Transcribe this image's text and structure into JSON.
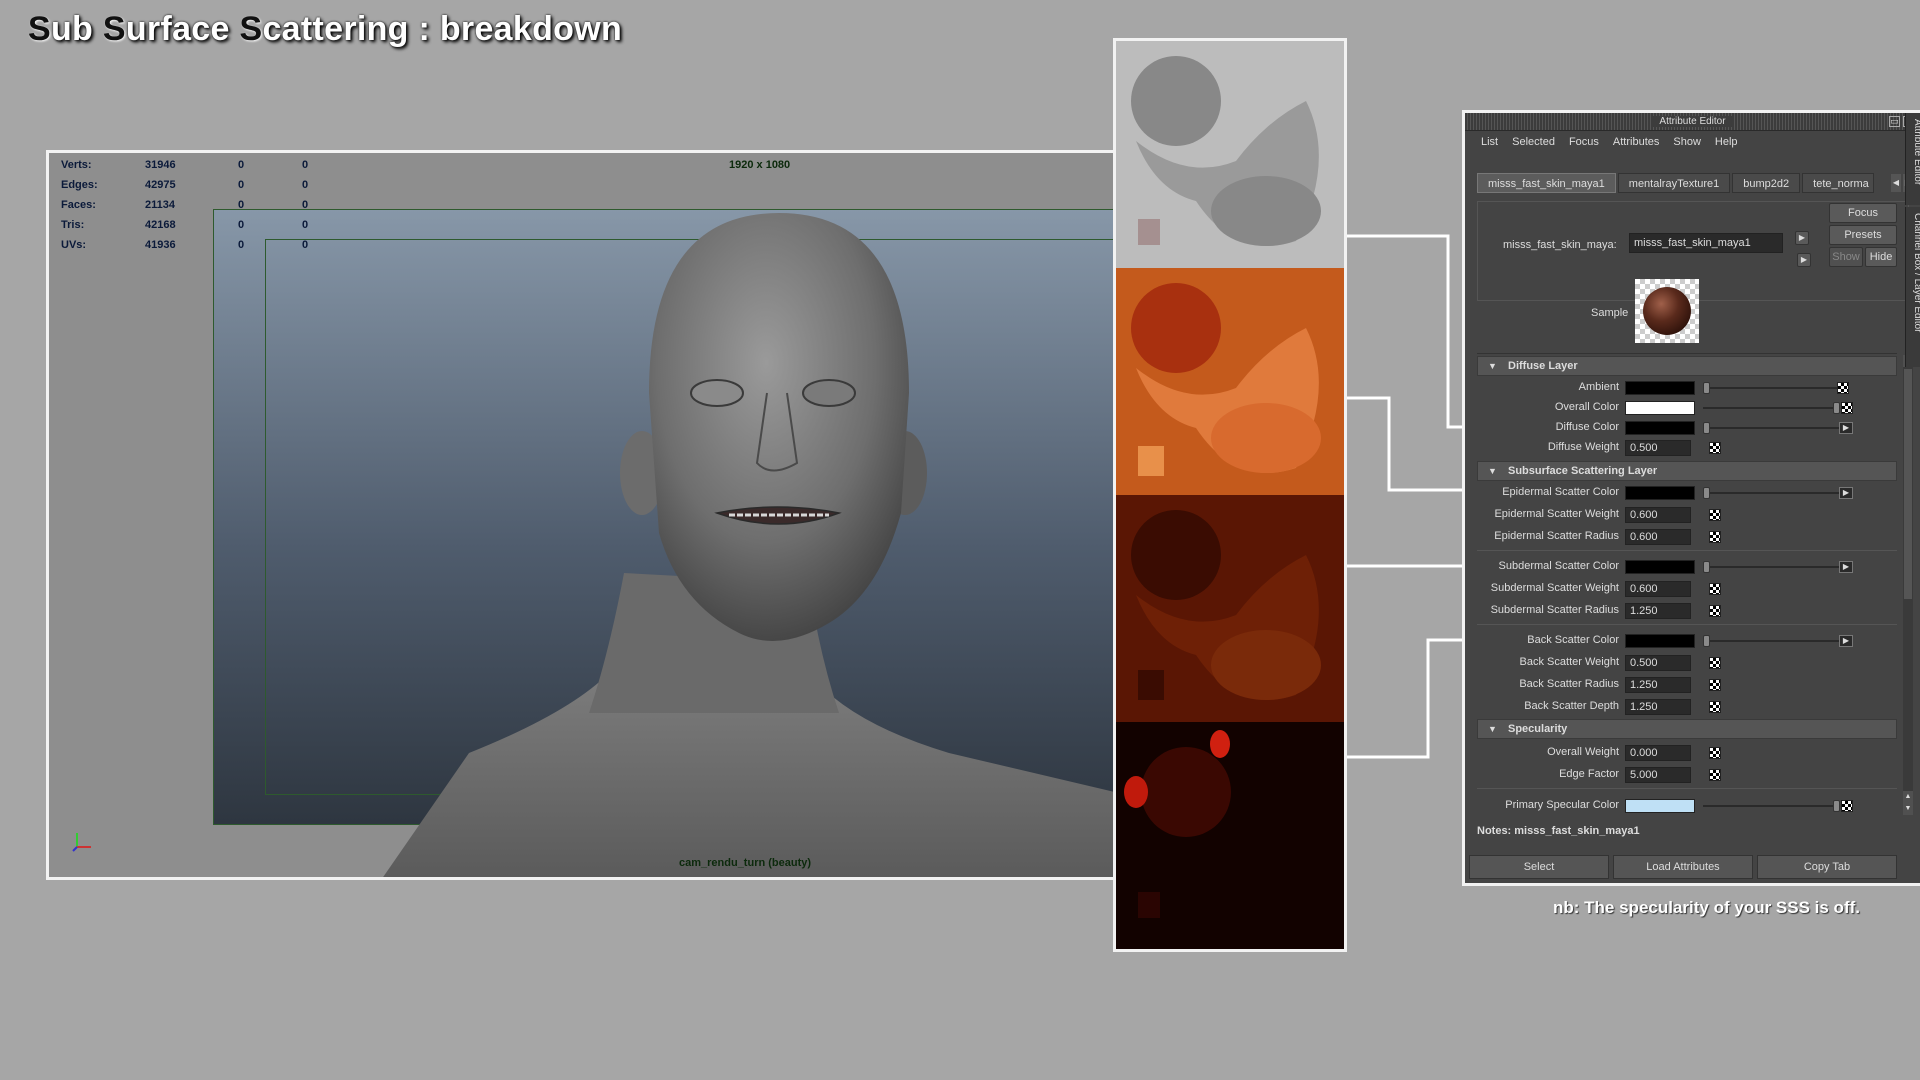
{
  "title": {
    "parts": [
      {
        "text": "S",
        "cap": true
      },
      {
        "text": "ub ",
        "cap": false
      },
      {
        "text": "S",
        "cap": true
      },
      {
        "text": "urface ",
        "cap": false
      },
      {
        "text": "S",
        "cap": true
      },
      {
        "text": "cattering : breakdown",
        "cap": false
      }
    ]
  },
  "viewport": {
    "hud": [
      {
        "label": "Verts:",
        "v1": "31946",
        "v2": "0",
        "v3": "0"
      },
      {
        "label": "Edges:",
        "v1": "42975",
        "v2": "0",
        "v3": "0"
      },
      {
        "label": "Faces:",
        "v1": "21134",
        "v2": "0",
        "v3": "0"
      },
      {
        "label": "Tris:",
        "v1": "42168",
        "v2": "0",
        "v3": "0"
      },
      {
        "label": "UVs:",
        "v1": "41936",
        "v2": "0",
        "v3": "0"
      }
    ],
    "resolution": "1920 x 1080",
    "camera": "cam_rendu_turn (beauty)"
  },
  "attribute_editor": {
    "title": "Attribute Editor",
    "menu": [
      "List",
      "Selected",
      "Focus",
      "Attributes",
      "Show",
      "Help"
    ],
    "tabs": [
      "misss_fast_skin_maya1",
      "mentalrayTexture1",
      "bump2d2",
      "tete_norma"
    ],
    "node_label": "misss_fast_skin_maya:",
    "node_value": "misss_fast_skin_maya1",
    "buttons": {
      "focus": "Focus",
      "presets": "Presets",
      "show": "Show",
      "hide": "Hide"
    },
    "sample_label": "Sample",
    "sections": {
      "diffuse": "Diffuse Layer",
      "sss": "Subsurface Scattering Layer",
      "spec": "Specularity"
    },
    "attrs": {
      "ambient": "Ambient",
      "overall_color": "Overall Color",
      "diffuse_color": "Diffuse Color",
      "diffuse_weight": {
        "label": "Diffuse Weight",
        "value": "0.500"
      },
      "epi_color": "Epidermal Scatter Color",
      "epi_weight": {
        "label": "Epidermal Scatter Weight",
        "value": "0.600"
      },
      "epi_radius": {
        "label": "Epidermal Scatter Radius",
        "value": "0.600"
      },
      "sub_color": "Subdermal Scatter Color",
      "sub_weight": {
        "label": "Subdermal Scatter Weight",
        "value": "0.600"
      },
      "sub_radius": {
        "label": "Subdermal Scatter Radius",
        "value": "1.250"
      },
      "back_color": "Back Scatter Color",
      "back_weight": {
        "label": "Back Scatter Weight",
        "value": "0.500"
      },
      "back_radius": {
        "label": "Back Scatter Radius",
        "value": "1.250"
      },
      "back_depth": {
        "label": "Back Scatter Depth",
        "value": "1.250"
      },
      "spec_weight": {
        "label": "Overall Weight",
        "value": "0.000"
      },
      "edge_factor": {
        "label": "Edge Factor",
        "value": "5.000"
      },
      "primary_spec": "Primary Specular Color"
    },
    "swatch_colors": {
      "ambient": "#000000",
      "overall": "#ffffff",
      "diffuse": "#000000",
      "epi": "#000000",
      "sub": "#000000",
      "back": "#000000",
      "primary_spec": "#bfe0f5"
    },
    "notes": "Notes:  misss_fast_skin_maya1",
    "bottom_buttons": [
      "Select",
      "Load Attributes",
      "Copy Tab"
    ],
    "side_tabs": [
      "Attribute Editor",
      "Channel Box / Layer Editor"
    ]
  },
  "note": "nb: The specularity of your SSS is off.",
  "icons": [
    "triangle-down-icon",
    "checker-map-icon",
    "connect-arrow-icon",
    "window-float-icon",
    "close-icon",
    "axis-gizmo-icon"
  ]
}
